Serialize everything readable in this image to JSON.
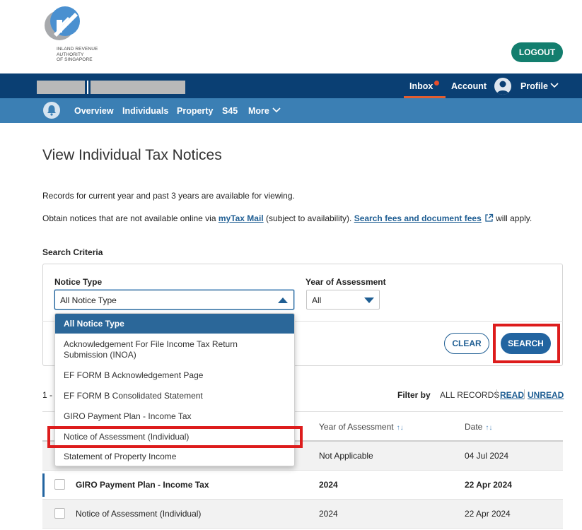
{
  "header": {
    "logo_lines": [
      "INLAND REVENUE",
      "AUTHORITY",
      "OF SINGAPORE"
    ],
    "logout_label": "LOGOUT"
  },
  "top_nav": {
    "inbox_label": "Inbox",
    "account_label": "Account",
    "profile_label": "Profile"
  },
  "sub_nav": {
    "items": [
      "Overview",
      "Individuals",
      "Property",
      "S45",
      "More"
    ]
  },
  "page": {
    "title": "View Individual Tax Notices",
    "info_line": "Records for current year and past 3 years are available for viewing.",
    "obtain_prefix": "Obtain notices that are not available online via ",
    "mytax_mail_link": "myTax Mail",
    "obtain_middle": " (subject to availability). ",
    "fees_link": "Search fees and document fees",
    "obtain_suffix": " will apply."
  },
  "search_criteria": {
    "label": "Search Criteria",
    "notice_type_label": "Notice Type",
    "notice_type_value": "All Notice Type",
    "year_label": "Year of Assessment",
    "year_value": "All",
    "clear_label": "CLEAR",
    "search_label": "SEARCH"
  },
  "notice_type_options": [
    "All Notice Type",
    "Acknowledgement For File Income Tax Return Submission (INOA)",
    "EF FORM B Acknowledgement Page",
    "EF FORM B Consolidated Statement",
    "GIRO Payment Plan - Income Tax",
    "Notice of Assessment (Individual)",
    "Statement of Property Income"
  ],
  "filter": {
    "results_prefix": "1 - 1",
    "label": "Filter by",
    "all_records": "ALL RECORDS",
    "read": "READ",
    "unread": "UNREAD"
  },
  "table": {
    "headers": {
      "year": "Year of Assessment",
      "date": "Date"
    },
    "rows": [
      {
        "name": "",
        "year": "Not Applicable",
        "date": "04 Jul 2024",
        "unread": false
      },
      {
        "name": "GIRO Payment Plan - Income Tax",
        "year": "2024",
        "date": "22 Apr 2024",
        "unread": true
      },
      {
        "name": "Notice of Assessment (Individual)",
        "year": "2024",
        "date": "22 Apr 2024",
        "unread": false
      }
    ]
  },
  "colors": {
    "nav_dark": "#0a3f73",
    "nav_light": "#3b7fb4",
    "logout_green": "#137e6e",
    "primary_blue": "#2264a0",
    "highlight_red": "#dd1c1c"
  }
}
